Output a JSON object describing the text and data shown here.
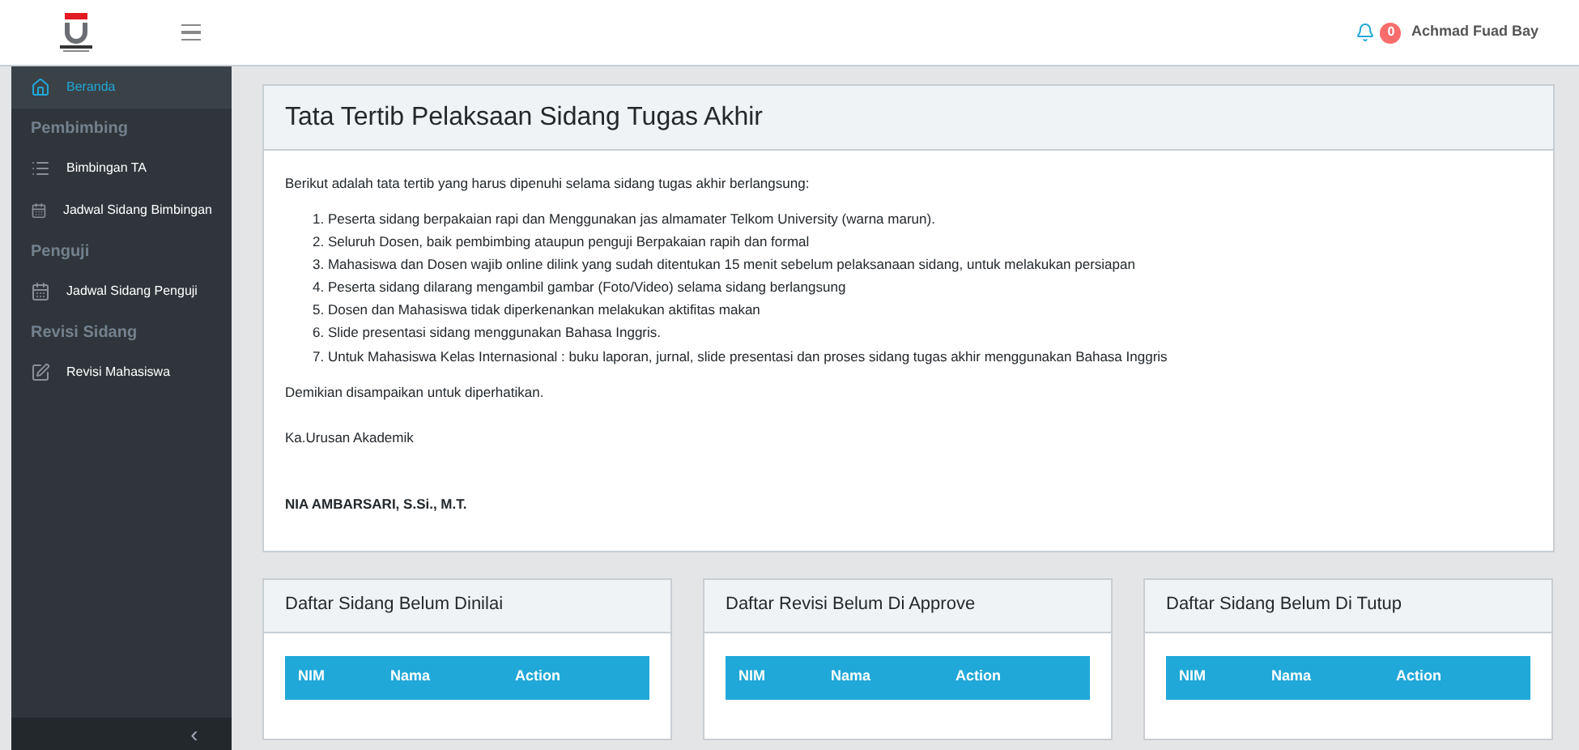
{
  "header": {
    "notification_count": "0",
    "user_name": "Achmad Fuad Bay"
  },
  "sidebar": {
    "items": [
      {
        "kind": "link",
        "label": "Beranda",
        "selected": true
      },
      {
        "kind": "section",
        "label": "Pembimbing"
      },
      {
        "kind": "link",
        "label": "Bimbingan TA",
        "selected": false
      },
      {
        "kind": "link",
        "label": "Jadwal Sidang Bimbingan",
        "selected": false
      },
      {
        "kind": "section",
        "label": "Penguji"
      },
      {
        "kind": "link",
        "label": "Jadwal Sidang Penguji",
        "selected": false
      },
      {
        "kind": "section",
        "label": "Revisi Sidang"
      },
      {
        "kind": "link",
        "label": "Revisi Mahasiswa",
        "selected": false
      }
    ],
    "collapse_button": "‹"
  },
  "rules_card": {
    "title": "Tata Tertib Pelaksaan Sidang Tugas Akhir",
    "intro": "Berikut adalah tata tertib yang harus dipenuhi selama sidang tugas akhir berlangsung:",
    "rules": [
      "1. Peserta sidang berpakaian rapi dan Menggunakan jas almamater Telkom University (warna marun).",
      "2. Seluruh Dosen, baik pembimbing ataupun penguji Berpakaian rapih dan formal",
      "3. Mahasiswa dan Dosen wajib online dilink yang sudah ditentukan 15 menit sebelum pelaksanaan sidang, untuk melakukan persiapan",
      "4. Peserta sidang dilarang mengambil gambar (Foto/Video) selama sidang berlangsung",
      "5. Dosen dan Mahasiswa tidak diperkenankan melakukan aktifitas makan",
      "6. Slide presentasi sidang menggunakan Bahasa Inggris.",
      "7. Untuk Mahasiswa Kelas Internasional : buku laporan, jurnal, slide presentasi dan proses sidang tugas akhir menggunakan Bahasa Inggris"
    ],
    "closing": "Demikian disampaikan untuk diperhatikan.",
    "position": "Ka.Urusan Akademik",
    "signatory": "NIA AMBARSARI, S.Si., M.T."
  },
  "tables": [
    {
      "title": "Daftar Sidang Belum Dinilai",
      "columns": [
        "NIM",
        "Nama",
        "Action"
      ]
    },
    {
      "title": "Daftar Revisi Belum Di Approve",
      "columns": [
        "NIM",
        "Nama",
        "Action"
      ]
    },
    {
      "title": "Daftar Sidang Belum Di Tutup",
      "columns": [
        "NIM",
        "Nama",
        "Action"
      ]
    }
  ]
}
